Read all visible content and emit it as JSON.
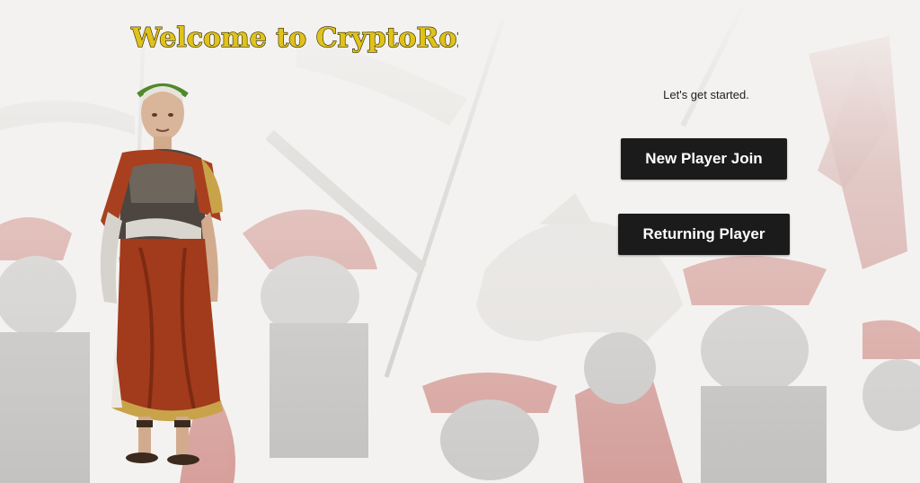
{
  "title": "Welcome to CryptoRome!",
  "prompt": "Let's get started.",
  "buttons": {
    "new_player": "New Player Join",
    "returning_player": "Returning Player"
  },
  "colors": {
    "title_fill": "#e0c21a",
    "title_outline": "#2a2200",
    "button_bg": "#1b1b1b",
    "button_text": "#ffffff",
    "background": "#f3f2f0",
    "accent_red": "#b43a2a"
  },
  "icons": {
    "hero": "julius-caesar-figure",
    "background": "roman-legion-battle-scene"
  }
}
